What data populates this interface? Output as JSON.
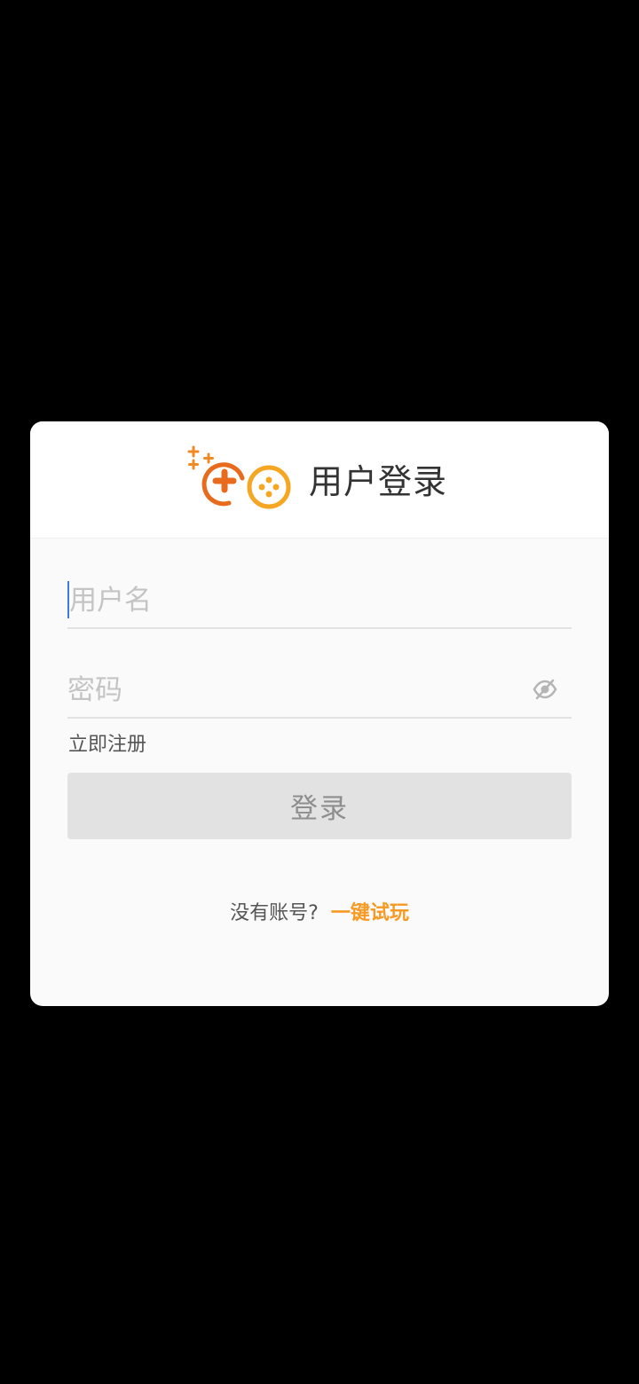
{
  "dialog": {
    "title": "用户登录",
    "logo_icon": "gamepad-logo-icon",
    "username": {
      "placeholder": "用户名",
      "value": ""
    },
    "password": {
      "placeholder": "密码",
      "value": "",
      "toggle_icon": "eye-off-icon"
    },
    "register_label": "立即注册",
    "login_label": "登录",
    "footer": {
      "prompt": "没有账号?",
      "trial_label": "一键试玩"
    }
  },
  "colors": {
    "background": "#000000",
    "dialog_body": "#fafafa",
    "dialog_header": "#ffffff",
    "accent_orange": "#f59a23",
    "logo_dark_orange": "#e86a1c",
    "logo_light_orange": "#f5a623",
    "caret_blue": "#3c7be0",
    "button_disabled": "#e2e2e2",
    "button_text_disabled": "#8e8e8e"
  }
}
